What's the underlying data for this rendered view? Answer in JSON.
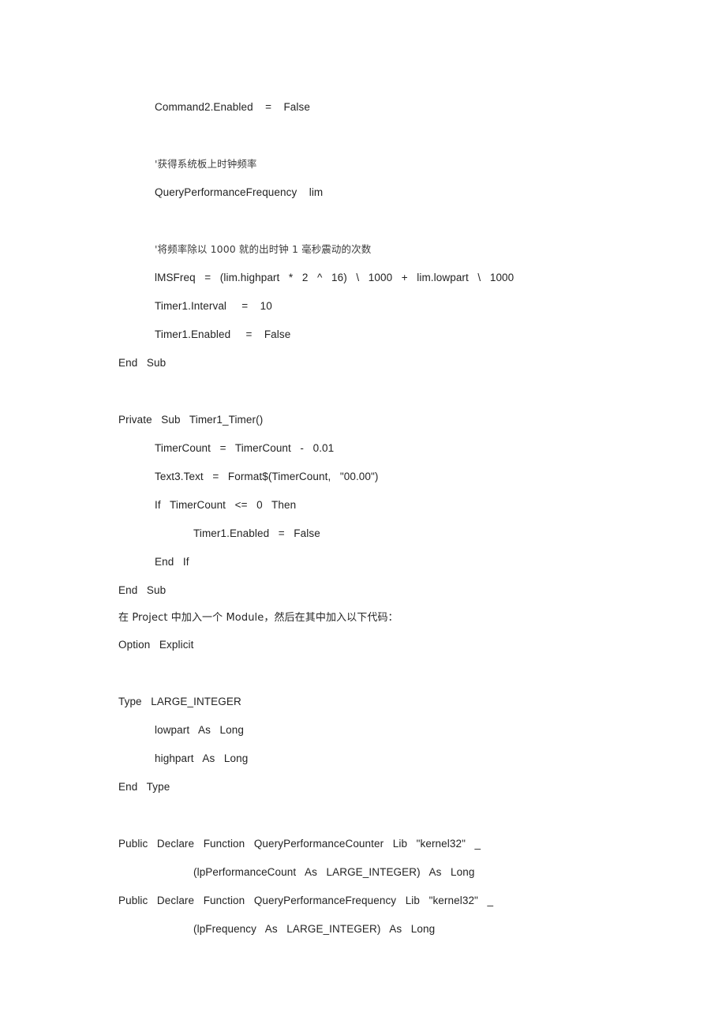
{
  "document": {
    "page_background": "#ffffff",
    "text_color": "#232323",
    "language": "Visual Basic",
    "lines": [
      {
        "id": "l01",
        "text": "Command2.Enabled    =    False",
        "indent": 1,
        "kind": "code"
      },
      {
        "id": "l02",
        "text": "",
        "indent": 0,
        "kind": "blank"
      },
      {
        "id": "l03",
        "text": "'获得系统板上时钟频率",
        "indent": 1,
        "kind": "comment-cjk"
      },
      {
        "id": "l04",
        "text": "QueryPerformanceFrequency    lim",
        "indent": 1,
        "kind": "code"
      },
      {
        "id": "l05",
        "text": "",
        "indent": 0,
        "kind": "blank"
      },
      {
        "id": "l06",
        "text": "'将频率除以 1000 就的出时钟 1 毫秒震动的次数",
        "indent": 1,
        "kind": "comment-cjk"
      },
      {
        "id": "l07",
        "text": "lMSFreq   =   (lim.highpart   *   2   ^   16)   \\   1000   +   lim.lowpart   \\   1000",
        "indent": 1,
        "kind": "code"
      },
      {
        "id": "l08",
        "text": "Timer1.Interval     =    10",
        "indent": 1,
        "kind": "code"
      },
      {
        "id": "l09",
        "text": "Timer1.Enabled     =    False",
        "indent": 1,
        "kind": "code"
      },
      {
        "id": "l10",
        "text": "End   Sub",
        "indent": 0,
        "kind": "code"
      },
      {
        "id": "l11",
        "text": "",
        "indent": 0,
        "kind": "blank"
      },
      {
        "id": "l12",
        "text": "Private   Sub   Timer1_Timer()",
        "indent": 0,
        "kind": "code"
      },
      {
        "id": "l13",
        "text": "TimerCount   =   TimerCount   -   0.01",
        "indent": 1,
        "kind": "code"
      },
      {
        "id": "l14",
        "text": "Text3.Text   =   Format$(TimerCount,   \"00.00\")",
        "indent": 1,
        "kind": "code"
      },
      {
        "id": "l15",
        "text": "If   TimerCount   <=   0   Then",
        "indent": 1,
        "kind": "code"
      },
      {
        "id": "l16",
        "text": "Timer1.Enabled   =   False",
        "indent": 2,
        "kind": "code"
      },
      {
        "id": "l17",
        "text": "End   If",
        "indent": 1,
        "kind": "code"
      },
      {
        "id": "l18",
        "text": "End   Sub",
        "indent": 0,
        "kind": "code"
      },
      {
        "id": "l19",
        "text": "在 Project 中加入一个 Module，然后在其中加入以下代码：",
        "indent": 0,
        "kind": "prose-cjk"
      },
      {
        "id": "l20",
        "text": "Option   Explicit",
        "indent": 0,
        "kind": "code"
      },
      {
        "id": "l21",
        "text": "",
        "indent": 0,
        "kind": "blank"
      },
      {
        "id": "l22",
        "text": "Type   LARGE_INTEGER",
        "indent": 0,
        "kind": "code"
      },
      {
        "id": "l23",
        "text": "lowpart   As   Long",
        "indent": 1,
        "kind": "code"
      },
      {
        "id": "l24",
        "text": "highpart   As   Long",
        "indent": 1,
        "kind": "code"
      },
      {
        "id": "l25",
        "text": "End   Type",
        "indent": 0,
        "kind": "code"
      },
      {
        "id": "l26",
        "text": "",
        "indent": 0,
        "kind": "blank"
      },
      {
        "id": "l27",
        "text": "Public   Declare   Function   QueryPerformanceCounter   Lib   \"kernel32\"   _",
        "indent": 0,
        "kind": "code"
      },
      {
        "id": "l28",
        "text": "(lpPerformanceCount   As   LARGE_INTEGER)   As   Long",
        "indent": 2,
        "kind": "code"
      },
      {
        "id": "l29",
        "text": "Public   Declare   Function   QueryPerformanceFrequency   Lib   \"kernel32\"   _",
        "indent": 0,
        "kind": "code"
      },
      {
        "id": "l30",
        "text": "(lpFrequency   As   LARGE_INTEGER)   As   Long",
        "indent": 2,
        "kind": "code"
      }
    ]
  }
}
